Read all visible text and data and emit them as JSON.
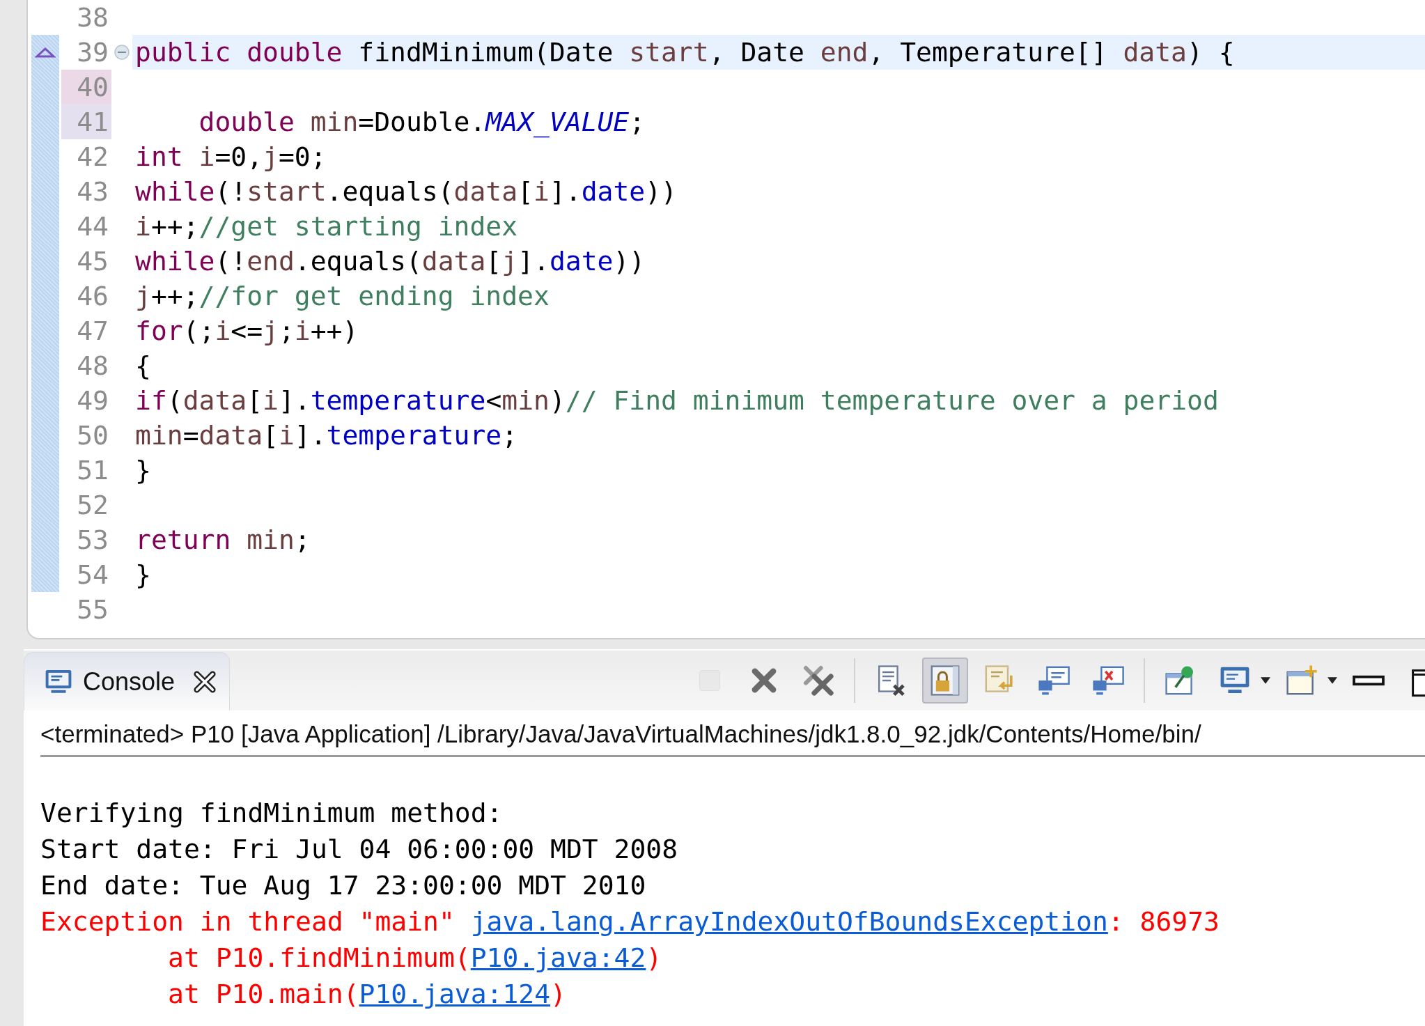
{
  "editor": {
    "lines": [
      {
        "number": "38",
        "range": false,
        "current": false,
        "added": false,
        "changed": false,
        "override": false,
        "collapsible": false
      },
      {
        "number": "39",
        "range": true,
        "current": true,
        "added": false,
        "changed": false,
        "override": true,
        "collapsible": true,
        "tokens": [
          {
            "kind": "keyword",
            "text": "public double"
          },
          {
            "kind": "plain",
            "text": " findMinimum(Date "
          },
          {
            "kind": "param",
            "text": "start"
          },
          {
            "kind": "plain",
            "text": ", Date "
          },
          {
            "kind": "param",
            "text": "end"
          },
          {
            "kind": "plain",
            "text": ", Temperature[] "
          },
          {
            "kind": "param",
            "text": "data"
          },
          {
            "kind": "plain",
            "text": ") {"
          }
        ]
      },
      {
        "number": "40",
        "range": true,
        "current": false,
        "added": true,
        "changed": false,
        "override": false,
        "collapsible": false
      },
      {
        "number": "41",
        "range": true,
        "current": false,
        "added": false,
        "changed": true,
        "override": false,
        "collapsible": false,
        "tokens": [
          {
            "kind": "keyword",
            "text": "    double"
          },
          {
            "kind": "local",
            "text": " min"
          },
          {
            "kind": "plain",
            "text": "=Double."
          },
          {
            "kind": "static",
            "text": "MAX_VALUE"
          },
          {
            "kind": "plain",
            "text": ";"
          }
        ]
      },
      {
        "number": "42",
        "range": true,
        "current": false,
        "added": false,
        "changed": false,
        "override": false,
        "collapsible": false,
        "tokens": [
          {
            "kind": "keyword",
            "text": "int"
          },
          {
            "kind": "local",
            "text": " i"
          },
          {
            "kind": "plain",
            "text": "=0,"
          },
          {
            "kind": "local",
            "text": "j"
          },
          {
            "kind": "plain",
            "text": "=0;"
          }
        ]
      },
      {
        "number": "43",
        "range": true,
        "current": false,
        "added": false,
        "changed": false,
        "override": false,
        "collapsible": false,
        "tokens": [
          {
            "kind": "keyword",
            "text": "while"
          },
          {
            "kind": "plain",
            "text": "(!"
          },
          {
            "kind": "param",
            "text": "start"
          },
          {
            "kind": "plain",
            "text": ".equals("
          },
          {
            "kind": "param",
            "text": "data"
          },
          {
            "kind": "plain",
            "text": "["
          },
          {
            "kind": "local",
            "text": "i"
          },
          {
            "kind": "plain",
            "text": "]."
          },
          {
            "kind": "field",
            "text": "date"
          },
          {
            "kind": "plain",
            "text": "))"
          }
        ]
      },
      {
        "number": "44",
        "range": true,
        "current": false,
        "added": false,
        "changed": false,
        "override": false,
        "collapsible": false,
        "tokens": [
          {
            "kind": "local",
            "text": "i"
          },
          {
            "kind": "plain",
            "text": "++;"
          },
          {
            "kind": "comment",
            "text": "//get starting index"
          }
        ]
      },
      {
        "number": "45",
        "range": true,
        "current": false,
        "added": false,
        "changed": false,
        "override": false,
        "collapsible": false,
        "tokens": [
          {
            "kind": "keyword",
            "text": "while"
          },
          {
            "kind": "plain",
            "text": "(!"
          },
          {
            "kind": "param",
            "text": "end"
          },
          {
            "kind": "plain",
            "text": ".equals("
          },
          {
            "kind": "param",
            "text": "data"
          },
          {
            "kind": "plain",
            "text": "["
          },
          {
            "kind": "local",
            "text": "j"
          },
          {
            "kind": "plain",
            "text": "]."
          },
          {
            "kind": "field",
            "text": "date"
          },
          {
            "kind": "plain",
            "text": "))"
          }
        ]
      },
      {
        "number": "46",
        "range": true,
        "current": false,
        "added": false,
        "changed": false,
        "override": false,
        "collapsible": false,
        "tokens": [
          {
            "kind": "local",
            "text": "j"
          },
          {
            "kind": "plain",
            "text": "++;"
          },
          {
            "kind": "comment",
            "text": "//for get ending index"
          }
        ]
      },
      {
        "number": "47",
        "range": true,
        "current": false,
        "added": false,
        "changed": false,
        "override": false,
        "collapsible": false,
        "tokens": [
          {
            "kind": "keyword",
            "text": "for"
          },
          {
            "kind": "plain",
            "text": "(;"
          },
          {
            "kind": "local",
            "text": "i"
          },
          {
            "kind": "plain",
            "text": "<="
          },
          {
            "kind": "local",
            "text": "j"
          },
          {
            "kind": "plain",
            "text": ";"
          },
          {
            "kind": "local",
            "text": "i"
          },
          {
            "kind": "plain",
            "text": "++)"
          }
        ]
      },
      {
        "number": "48",
        "range": true,
        "current": false,
        "added": false,
        "changed": false,
        "override": false,
        "collapsible": false,
        "tokens": [
          {
            "kind": "plain",
            "text": "{"
          }
        ]
      },
      {
        "number": "49",
        "range": true,
        "current": false,
        "added": false,
        "changed": false,
        "override": false,
        "collapsible": false,
        "tokens": [
          {
            "kind": "keyword",
            "text": "if"
          },
          {
            "kind": "plain",
            "text": "("
          },
          {
            "kind": "param",
            "text": "data"
          },
          {
            "kind": "plain",
            "text": "["
          },
          {
            "kind": "local",
            "text": "i"
          },
          {
            "kind": "plain",
            "text": "]."
          },
          {
            "kind": "field",
            "text": "temperature"
          },
          {
            "kind": "plain",
            "text": "<"
          },
          {
            "kind": "local",
            "text": "min"
          },
          {
            "kind": "plain",
            "text": ")"
          },
          {
            "kind": "comment",
            "text": "// Find minimum temperature over a period"
          }
        ]
      },
      {
        "number": "50",
        "range": true,
        "current": false,
        "added": false,
        "changed": false,
        "override": false,
        "collapsible": false,
        "tokens": [
          {
            "kind": "local",
            "text": "min"
          },
          {
            "kind": "plain",
            "text": "="
          },
          {
            "kind": "param",
            "text": "data"
          },
          {
            "kind": "plain",
            "text": "["
          },
          {
            "kind": "local",
            "text": "i"
          },
          {
            "kind": "plain",
            "text": "]."
          },
          {
            "kind": "field",
            "text": "temperature"
          },
          {
            "kind": "plain",
            "text": ";"
          }
        ]
      },
      {
        "number": "51",
        "range": true,
        "current": false,
        "added": false,
        "changed": false,
        "override": false,
        "collapsible": false,
        "tokens": [
          {
            "kind": "plain",
            "text": "}"
          }
        ]
      },
      {
        "number": "52",
        "range": true,
        "current": false,
        "added": false,
        "changed": false,
        "override": false,
        "collapsible": false
      },
      {
        "number": "53",
        "range": true,
        "current": false,
        "added": false,
        "changed": false,
        "override": false,
        "collapsible": false,
        "tokens": [
          {
            "kind": "keyword",
            "text": "return"
          },
          {
            "kind": "local",
            "text": " min"
          },
          {
            "kind": "plain",
            "text": ";"
          }
        ]
      },
      {
        "number": "54",
        "range": true,
        "current": false,
        "added": false,
        "changed": false,
        "override": false,
        "collapsible": false,
        "tokens": [
          {
            "kind": "plain",
            "text": "}"
          }
        ]
      },
      {
        "number": "55",
        "range": false,
        "current": false,
        "added": false,
        "changed": false,
        "override": false,
        "collapsible": false
      }
    ]
  },
  "console": {
    "tab": {
      "label": "Console"
    },
    "toolbar": [
      {
        "kind": "stop",
        "disabled": true,
        "selected": false
      },
      {
        "kind": "remove",
        "disabled": false,
        "selected": false
      },
      {
        "kind": "remove-all",
        "disabled": false,
        "selected": false
      },
      {
        "kind": "separator"
      },
      {
        "kind": "clear",
        "disabled": false,
        "selected": false
      },
      {
        "kind": "scroll-lock",
        "disabled": false,
        "selected": true
      },
      {
        "kind": "word-wrap",
        "disabled": false,
        "selected": false
      },
      {
        "kind": "show-out",
        "disabled": false,
        "selected": false
      },
      {
        "kind": "show-err",
        "disabled": false,
        "selected": false
      },
      {
        "kind": "separator"
      },
      {
        "kind": "pin",
        "disabled": false,
        "selected": false
      },
      {
        "kind": "display",
        "disabled": false,
        "selected": false
      },
      {
        "kind": "open",
        "disabled": false,
        "selected": false
      },
      {
        "kind": "minimize",
        "disabled": false,
        "selected": false
      },
      {
        "kind": "maximize",
        "disabled": false,
        "selected": false
      }
    ],
    "header": "<terminated> P10 [Java Application] /Library/Java/JavaVirtualMachines/jdk1.8.0_92.jdk/Contents/Home/bin/",
    "output": [
      [
        {
          "kind": "out",
          "text": "Verifying findMinimum method:"
        }
      ],
      [
        {
          "kind": "out",
          "text": "Start date: Fri Jul 04 06:00:00 MDT 2008"
        }
      ],
      [
        {
          "kind": "out",
          "text": "End date: Tue Aug 17 23:00:00 MDT 2010"
        }
      ],
      [
        {
          "kind": "err",
          "text": "Exception in thread \"main\" "
        },
        {
          "kind": "link",
          "text": "java.lang.ArrayIndexOutOfBoundsException"
        },
        {
          "kind": "err",
          "text": ": 86973"
        }
      ],
      [
        {
          "kind": "err",
          "text": "        at P10.findMinimum("
        },
        {
          "kind": "link",
          "text": "P10.java:42"
        },
        {
          "kind": "err",
          "text": ")"
        }
      ],
      [
        {
          "kind": "err",
          "text": "        at P10.main("
        },
        {
          "kind": "link",
          "text": "P10.java:124"
        },
        {
          "kind": "err",
          "text": ")"
        }
      ]
    ]
  }
}
